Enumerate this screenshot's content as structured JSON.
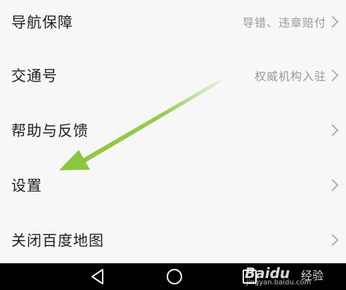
{
  "menu": {
    "items": [
      {
        "label": "导航保障",
        "hint": "导错、违章赔付"
      },
      {
        "label": "交通号",
        "hint": "权威机构入驻"
      },
      {
        "label": "帮助与反馈",
        "hint": ""
      },
      {
        "label": "设置",
        "hint": ""
      },
      {
        "label": "关闭百度地图",
        "hint": ""
      }
    ]
  },
  "annotation": {
    "arrow_color": "#8cc63f"
  },
  "watermark": {
    "logo": "Baidu",
    "cn": "经验",
    "url": "jingyan.baidu.com"
  },
  "navbar": {
    "buttons": [
      "back-icon",
      "home-icon",
      "recents-icon"
    ]
  }
}
